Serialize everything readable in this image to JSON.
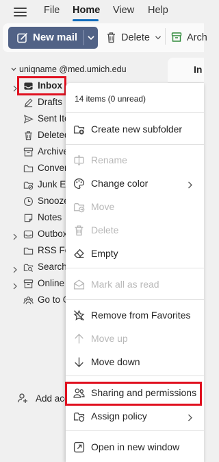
{
  "topbar": {
    "menus": [
      "File",
      "Home",
      "View",
      "Help"
    ]
  },
  "ribbon": {
    "new_mail": "New mail",
    "delete": "Delete",
    "archive": "Arch"
  },
  "account": {
    "name": "uniqname @med.umich.edu"
  },
  "folders": [
    {
      "label": "Inbox",
      "icon": "inbox-icon",
      "expandable": true
    },
    {
      "label": "Drafts",
      "icon": "pencil-icon",
      "expandable": false
    },
    {
      "label": "Sent Ite",
      "icon": "send-icon",
      "expandable": false
    },
    {
      "label": "Deleted",
      "icon": "trash-icon",
      "expandable": false
    },
    {
      "label": "Archive",
      "icon": "archive-icon",
      "expandable": false
    },
    {
      "label": "Convers",
      "icon": "folder-icon",
      "expandable": false
    },
    {
      "label": "Junk Em",
      "icon": "junk-folder-icon",
      "expandable": false
    },
    {
      "label": "Snoozec",
      "icon": "clock-icon",
      "expandable": false
    },
    {
      "label": "Notes",
      "icon": "note-icon",
      "expandable": false
    },
    {
      "label": "Outbox",
      "icon": "outbox-icon",
      "expandable": true
    },
    {
      "label": "RSS Fee",
      "icon": "folder-icon",
      "expandable": false
    },
    {
      "label": "Search F",
      "icon": "search-folder-icon",
      "expandable": true
    },
    {
      "label": "Online A",
      "icon": "archive-icon",
      "expandable": true
    },
    {
      "label": "Go to G",
      "icon": "groups-icon",
      "expandable": false
    }
  ],
  "add_account": "Add acco",
  "message_list": {
    "tab": "In"
  },
  "context_menu": {
    "header": "14 items (0 unread)",
    "items": [
      {
        "label": "Create new subfolder",
        "icon": "new-folder-icon",
        "disabled": false,
        "submenu": false
      },
      {
        "label": "Rename",
        "icon": "rename-icon",
        "disabled": true,
        "submenu": false
      },
      {
        "label": "Change color",
        "icon": "palette-icon",
        "disabled": false,
        "submenu": true
      },
      {
        "label": "Move",
        "icon": "move-folder-icon",
        "disabled": true,
        "submenu": false
      },
      {
        "label": "Delete",
        "icon": "trash-icon",
        "disabled": true,
        "submenu": false
      },
      {
        "label": "Empty",
        "icon": "eraser-icon",
        "disabled": false,
        "submenu": false
      },
      {
        "label": "Mark all as read",
        "icon": "mail-read-icon",
        "disabled": true,
        "submenu": false
      },
      {
        "label": "Remove from Favorites",
        "icon": "star-off-icon",
        "disabled": false,
        "submenu": false
      },
      {
        "label": "Move up",
        "icon": "arrow-up-icon",
        "disabled": true,
        "submenu": false
      },
      {
        "label": "Move down",
        "icon": "arrow-down-icon",
        "disabled": false,
        "submenu": false
      },
      {
        "label": "Sharing and permissions",
        "icon": "people-icon",
        "disabled": false,
        "submenu": false
      },
      {
        "label": "Assign policy",
        "icon": "policy-icon",
        "disabled": false,
        "submenu": true
      },
      {
        "label": "Open in new window",
        "icon": "open-window-icon",
        "disabled": false,
        "submenu": false
      }
    ]
  },
  "colors": {
    "accent": "#516286",
    "highlight": "#e0101f",
    "tab_underline": "#0f6cbd"
  }
}
